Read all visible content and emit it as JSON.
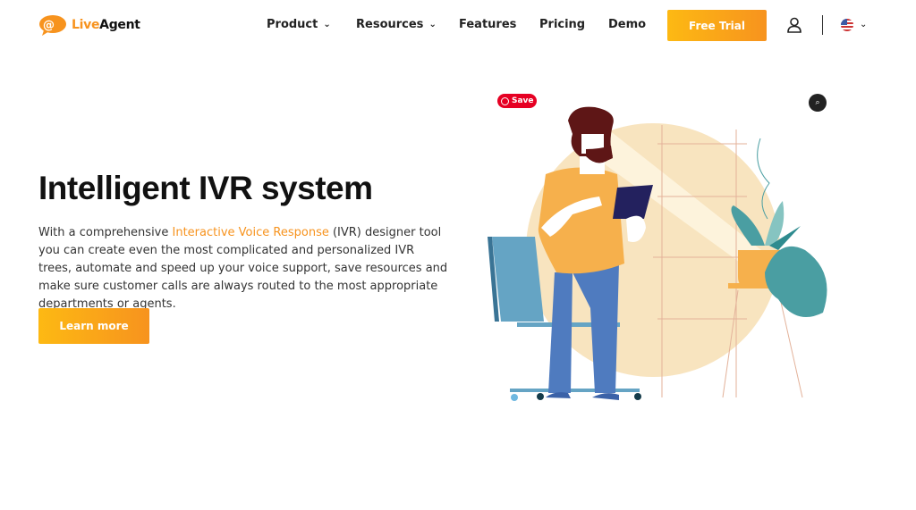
{
  "header": {
    "logo": {
      "part1": "Live",
      "part2": "Agent"
    },
    "nav": [
      {
        "label": "Product",
        "dropdown": true
      },
      {
        "label": "Resources",
        "dropdown": true
      },
      {
        "label": "Features"
      },
      {
        "label": "Pricing"
      },
      {
        "label": "Demo"
      }
    ],
    "cta": "Free Trial",
    "icons": {
      "account": "user-icon",
      "language": "us-flag-icon"
    }
  },
  "hero": {
    "title": "Intelligent IVR system",
    "desc_before": "With a comprehensive ",
    "desc_link": "Interactive Voice Response",
    "desc_after": " (IVR) designer tool you can create even the most complicated and personalized IVR trees, automate and speed up your voice support, save resources and make sure customer calls are always routed to the most appropriate departments or agents.",
    "button": "Learn more"
  },
  "image_overlay": {
    "pin_label": "Save",
    "lens_icon": "visual-search-icon"
  },
  "colors": {
    "accent": "#f7931e",
    "pinterest": "#e60023"
  }
}
